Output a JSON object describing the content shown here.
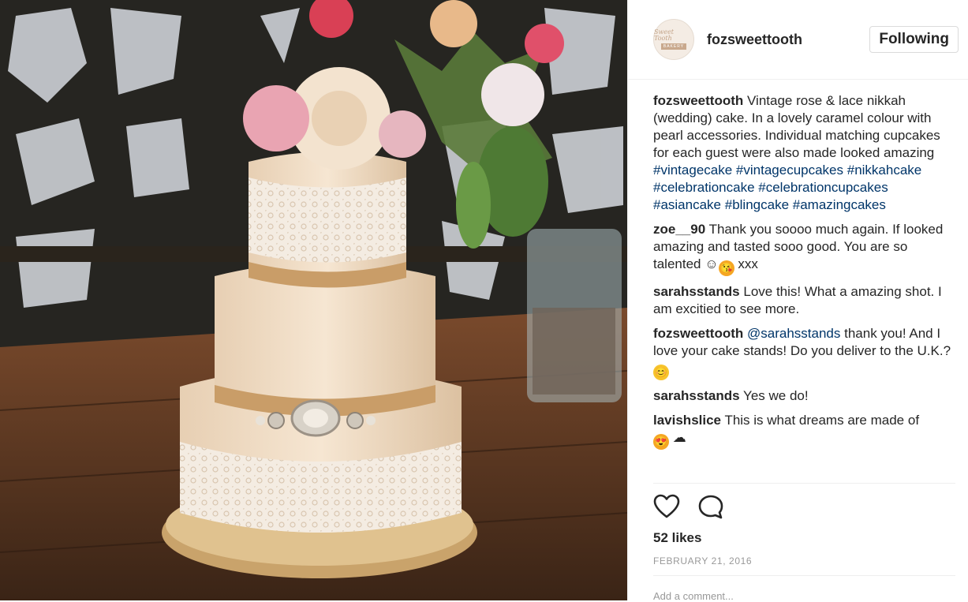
{
  "post": {
    "username": "fozsweettooth",
    "follow_label": "Following",
    "avatar_text": "Sweet Tooth",
    "avatar_sub": "BAKERY"
  },
  "comments": [
    {
      "user": "fozsweettooth",
      "text": "Vintage rose & lace nikkah (wedding) cake. In a lovely caramel colour with pearl accessories. Individual matching cupcakes for each guest were also made looked amazing",
      "tags": [
        "#vintagecake",
        "#vintagecupcakes",
        "#nikkahcake",
        "#celebrationcake",
        "#celebrationcupcakes",
        "#asiancake",
        "#blingcake",
        "#amazingcakes"
      ]
    },
    {
      "user": "zoe__90",
      "text": "Thank you soooo much again. If looked amazing and tasted sooo good. You are so talented",
      "emoji1": "☺",
      "emoji2": "😘",
      "tail": "xxx"
    },
    {
      "user": "sarahsstands",
      "text": "Love this! What a amazing shot. I am excitied to see more."
    },
    {
      "user": "fozsweettooth",
      "mention": "@sarahsstands",
      "text": "thank you! And I love your cake stands! Do you deliver to the U.K.?",
      "emoji": "😊"
    },
    {
      "user": "sarahsstands",
      "text": "Yes we do!"
    },
    {
      "user": "lavishslice",
      "text": "This is what dreams are made of",
      "emoji1": "😍",
      "emoji2": "☁"
    }
  ],
  "actions": {
    "like_icon": "heart-icon",
    "comment_icon": "speech-bubble-icon"
  },
  "likes": "52 likes",
  "date": "FEBRUARY 21, 2016",
  "add_comment_placeholder": "Add a comment..."
}
